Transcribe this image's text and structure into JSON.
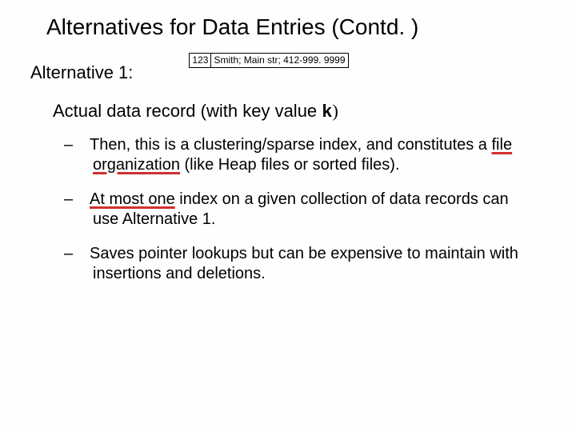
{
  "title": "Alternatives for Data Entries (Contd. )",
  "alt_label": "Alternative 1:",
  "record": {
    "key": "123",
    "rest": "Smith;  Main str;  412-999. 9999"
  },
  "heading2_pre": "Actual data record (with key value ",
  "heading2_k": "k",
  "heading2_post": ")",
  "bullets": [
    {
      "pre": "Then, this is a clustering/sparse index, and constitutes a ",
      "u": "file organization",
      "post": " (like Heap files or sorted files)."
    },
    {
      "pre": "",
      "u": "At most one",
      "post": " index on a given collection of data records can use Alternative 1."
    },
    {
      "pre": "Saves pointer lookups but can be expensive to maintain with insertions and deletions.",
      "u": "",
      "post": ""
    }
  ]
}
